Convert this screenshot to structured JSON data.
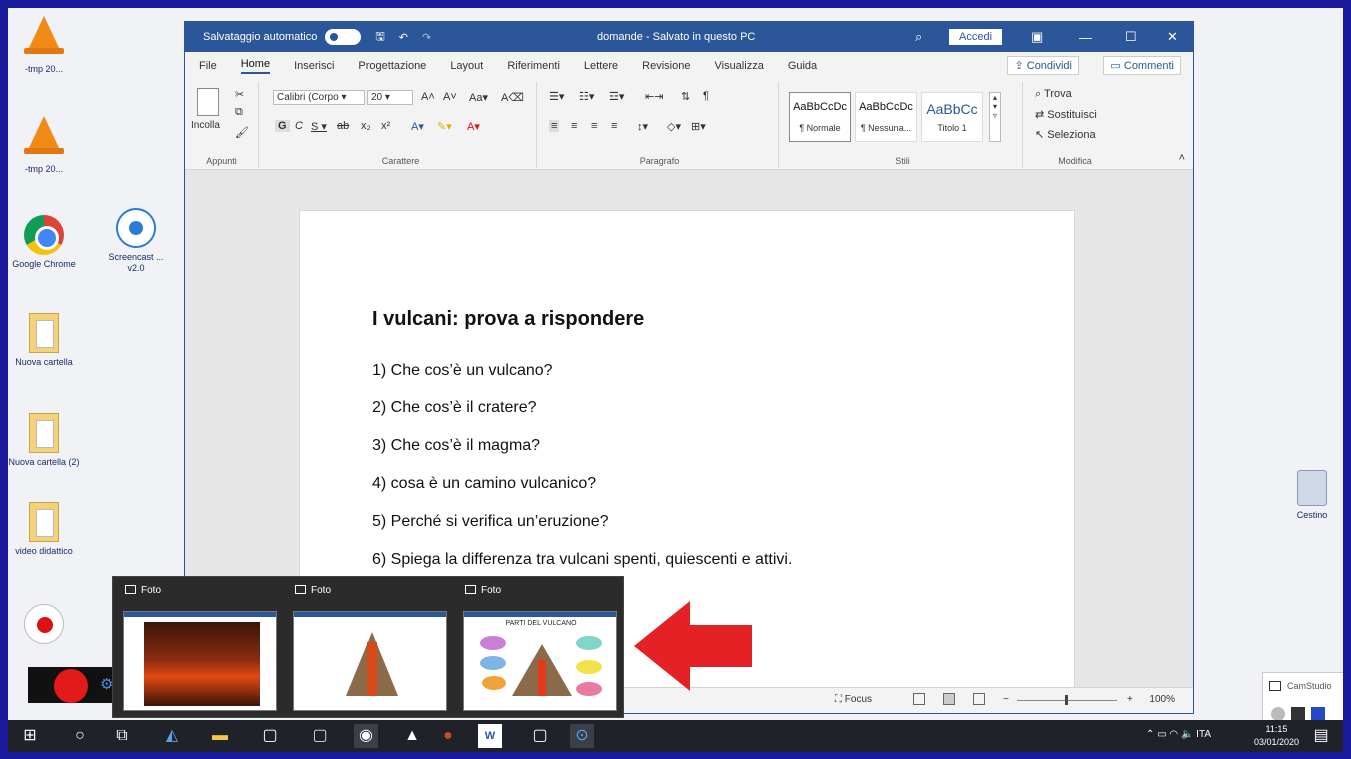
{
  "desktop": {
    "icons": [
      {
        "label": "-tmp 20...",
        "kind": "vlc"
      },
      {
        "label": "-tmp 20...",
        "kind": "vlc"
      },
      {
        "label": "Google Chrome",
        "kind": "chrome"
      },
      {
        "label": "Screencast ... v2.0",
        "kind": "screencast"
      },
      {
        "label": "Nuova cartella",
        "kind": "folder"
      },
      {
        "label": "Nuova cartella (2)",
        "kind": "folder"
      },
      {
        "label": "video didattico",
        "kind": "folder"
      },
      {
        "label": "Cestino",
        "kind": "recycle-bin"
      }
    ]
  },
  "word": {
    "titlebar": {
      "autosave_label": "Salvataggio automatico",
      "doc_name": "domande - Salvato in questo PC",
      "signin": "Accedi"
    },
    "menu": [
      "File",
      "Home",
      "Inserisci",
      "Progettazione",
      "Layout",
      "Riferimenti",
      "Lettere",
      "Revisione",
      "Visualizza",
      "Guida"
    ],
    "share": "Condividi",
    "comments": "Commenti",
    "ribbon": {
      "clipboard": {
        "paste": "Incolla",
        "label": "Appunti"
      },
      "font": {
        "font_name": "Calibri (Corpo",
        "font_size": "20",
        "label": "Carattere"
      },
      "paragraph": {
        "label": "Paragrafo"
      },
      "styles": {
        "items": [
          {
            "preview": "AaBbCcDc",
            "name": "¶ Normale"
          },
          {
            "preview": "AaBbCcDc",
            "name": "¶ Nessuna..."
          },
          {
            "preview": "AaBbCc",
            "name": "Titolo 1"
          }
        ],
        "label": "Stili"
      },
      "editing": {
        "find": "Trova",
        "replace": "Sostituisci",
        "select": "Seleziona",
        "label": "Modifica"
      }
    },
    "document": {
      "heading": "I vulcani: prova a rispondere",
      "questions": [
        "1) Che cos’è un vulcano?",
        "2) Che cos’è il cratere?",
        "3) Che cos’è il magma?",
        "4) cosa è un camino vulcanico?",
        "5) Perché si verifica un’eruzione?",
        "6) Spiega la differenza tra vulcani spenti, quiescenti e attivi."
      ]
    },
    "status": {
      "focus": "Focus",
      "zoom": "100%"
    }
  },
  "thumbnails": [
    {
      "label": "Foto",
      "content": "eruption photo"
    },
    {
      "label": "Foto",
      "content": "volcano cross-section"
    },
    {
      "label": "Foto",
      "content": "PARTI DEL VULCANO"
    }
  ],
  "camstudio": {
    "title": "CamStudio"
  },
  "taskbar": {
    "tray_lang": "ITA",
    "time": "11:15",
    "date": "03/01/2020"
  }
}
